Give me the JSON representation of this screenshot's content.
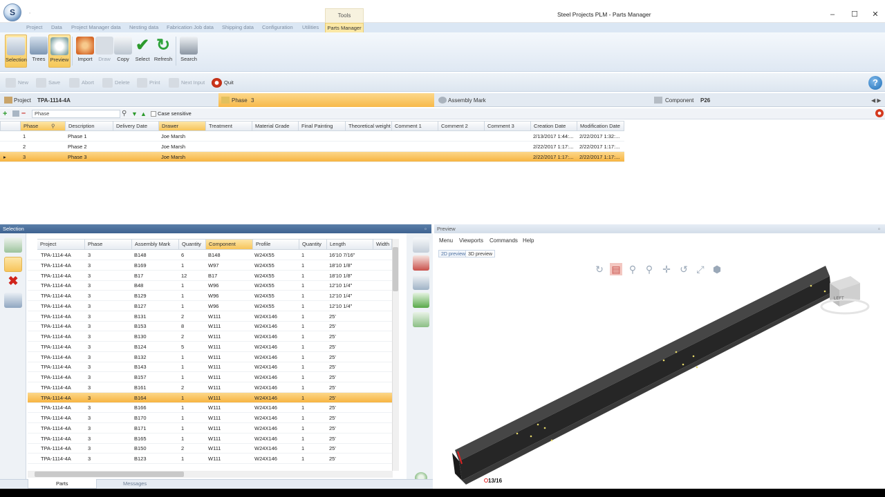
{
  "window": {
    "title": "Steel Projects PLM - Parts Manager",
    "context_tab": "Tools",
    "qat": "∙"
  },
  "tabs": [
    "Project",
    "Data",
    "Project Manager data",
    "Nesting data",
    "Fabrication Job data",
    "Shipping data",
    "Configuration",
    "Utilities",
    "Parts Manager"
  ],
  "ribbon": [
    "Selection",
    "Trees",
    "Preview",
    "Import",
    "Draw",
    "Copy",
    "Select",
    "Refresh",
    "Search"
  ],
  "actions": [
    "New",
    "Save",
    "Abort",
    "Delete",
    "Print",
    "Next Input",
    "Quit"
  ],
  "breadcrumb": {
    "project_label": "Project",
    "project_value": "TPA-1114-4A",
    "phase_label": "Phase",
    "phase_value": "3",
    "assembly_label": "Assembly Mark",
    "component_label": "Component",
    "component_value": "P26"
  },
  "filter": {
    "field": "Phase",
    "case_sensitive": "Case sensitive"
  },
  "phase_grid": {
    "headers": [
      "Phase",
      "Description",
      "Delivery Date",
      "Drawer",
      "Treatment",
      "Material Grade",
      "Final Painting",
      "Theoretical weight",
      "Comment 1",
      "Comment 2",
      "Comment 3",
      "Creation Date",
      "Modification Date"
    ],
    "rows": [
      {
        "phase": "1",
        "description": "Phase 1",
        "drawer": "Joe Marsh",
        "created": "2/13/2017 1:44:...",
        "modified": "2/22/2017 1:32:..."
      },
      {
        "phase": "2",
        "description": "Phase 2",
        "drawer": "Joe Marsh",
        "created": "2/22/2017 1:17:...",
        "modified": "2/22/2017 1:17:..."
      },
      {
        "phase": "3",
        "description": "Phase 3",
        "drawer": "Joe Marsh",
        "created": "2/22/2017 1:17:...",
        "modified": "2/22/2017 1:17:..."
      }
    ],
    "selected_index": 2
  },
  "selection_panel": {
    "title": "Selection",
    "pin": "∙",
    "headers": [
      "Project",
      "Phase",
      "Assembly Mark",
      "Quantity",
      "Component",
      "Profile",
      "Quantity",
      "Length",
      "Width"
    ],
    "rows": [
      [
        "TPA-1114-4A",
        "3",
        "B148",
        "6",
        "B148",
        "W24X55",
        "1",
        "16'10 7/16\""
      ],
      [
        "TPA-1114-4A",
        "3",
        "B169",
        "1",
        "W97",
        "W24X55",
        "1",
        "18'10 1/8\""
      ],
      [
        "TPA-1114-4A",
        "3",
        "B17",
        "12",
        "B17",
        "W24X55",
        "1",
        "18'10 1/8\""
      ],
      [
        "TPA-1114-4A",
        "3",
        "B48",
        "1",
        "W96",
        "W24X55",
        "1",
        "12'10 1/4\""
      ],
      [
        "TPA-1114-4A",
        "3",
        "B129",
        "1",
        "W96",
        "W24X55",
        "1",
        "12'10 1/4\""
      ],
      [
        "TPA-1114-4A",
        "3",
        "B127",
        "1",
        "W96",
        "W24X55",
        "1",
        "12'10 1/4\""
      ],
      [
        "TPA-1114-4A",
        "3",
        "B131",
        "2",
        "W111",
        "W24X146",
        "1",
        "25'"
      ],
      [
        "TPA-1114-4A",
        "3",
        "B153",
        "8",
        "W111",
        "W24X146",
        "1",
        "25'"
      ],
      [
        "TPA-1114-4A",
        "3",
        "B130",
        "2",
        "W111",
        "W24X146",
        "1",
        "25'"
      ],
      [
        "TPA-1114-4A",
        "3",
        "B124",
        "5",
        "W111",
        "W24X146",
        "1",
        "25'"
      ],
      [
        "TPA-1114-4A",
        "3",
        "B132",
        "1",
        "W111",
        "W24X146",
        "1",
        "25'"
      ],
      [
        "TPA-1114-4A",
        "3",
        "B143",
        "1",
        "W111",
        "W24X146",
        "1",
        "25'"
      ],
      [
        "TPA-1114-4A",
        "3",
        "B157",
        "1",
        "W111",
        "W24X146",
        "1",
        "25'"
      ],
      [
        "TPA-1114-4A",
        "3",
        "B161",
        "2",
        "W111",
        "W24X146",
        "1",
        "25'"
      ],
      [
        "TPA-1114-4A",
        "3",
        "B164",
        "1",
        "W111",
        "W24X146",
        "1",
        "25'"
      ],
      [
        "TPA-1114-4A",
        "3",
        "B166",
        "1",
        "W111",
        "W24X146",
        "1",
        "25'"
      ],
      [
        "TPA-1114-4A",
        "3",
        "B170",
        "1",
        "W111",
        "W24X146",
        "1",
        "25'"
      ],
      [
        "TPA-1114-4A",
        "3",
        "B171",
        "1",
        "W111",
        "W24X146",
        "1",
        "25'"
      ],
      [
        "TPA-1114-4A",
        "3",
        "B165",
        "1",
        "W111",
        "W24X146",
        "1",
        "25'"
      ],
      [
        "TPA-1114-4A",
        "3",
        "B150",
        "2",
        "W111",
        "W24X146",
        "1",
        "25'"
      ],
      [
        "TPA-1114-4A",
        "3",
        "B123",
        "1",
        "W111",
        "W24X146",
        "1",
        "25'"
      ]
    ],
    "selected_index": 14,
    "bottom_tabs": [
      "Parts",
      "Messages"
    ]
  },
  "preview": {
    "title": "Preview",
    "menu": [
      "Menu",
      "Viewports",
      "Commands",
      "Help"
    ],
    "view_tabs": [
      "2D preview",
      "3D preview"
    ],
    "cube_label": "LEFT",
    "dimension": "13/16"
  },
  "colors": {
    "selection": "#f7b441",
    "ribbon_bg": "#dfe8f3",
    "panel_header": "#3e6290",
    "beam": "#2e2e2e"
  }
}
